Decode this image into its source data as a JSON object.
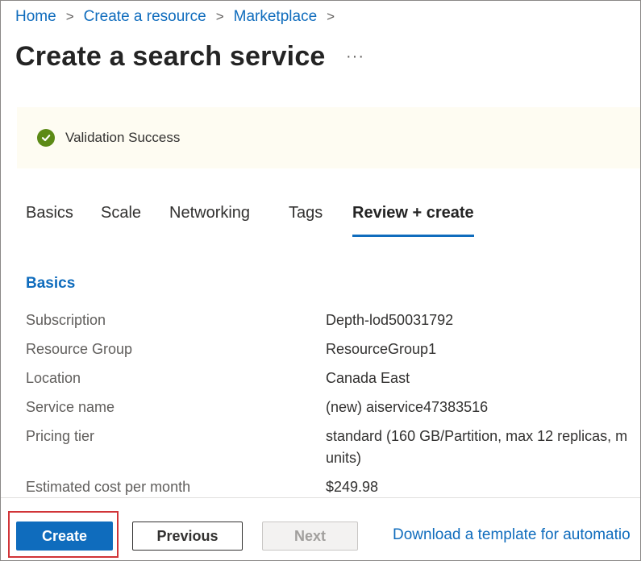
{
  "breadcrumb": {
    "items": [
      "Home",
      "Create a resource",
      "Marketplace"
    ],
    "separator": ">"
  },
  "page": {
    "title": "Create a search service",
    "more_label": "···"
  },
  "banner": {
    "icon": "check-circle-icon",
    "text": "Validation Success",
    "color_success": "#5c8a16"
  },
  "tabs": [
    {
      "label": "Basics"
    },
    {
      "label": "Scale"
    },
    {
      "label": "Networking"
    },
    {
      "label": "Tags"
    },
    {
      "label": "Review + create",
      "active": true
    }
  ],
  "section": {
    "title": "Basics",
    "rows": [
      {
        "label": "Subscription",
        "value": "Depth-lod50031792"
      },
      {
        "label": "Resource Group",
        "value": "ResourceGroup1"
      },
      {
        "label": "Location",
        "value": "Canada East"
      },
      {
        "label": "Service name",
        "value": "(new) aiservice47383516"
      },
      {
        "label": "Pricing tier",
        "value": "standard (160 GB/Partition, max 12 replicas, m",
        "value_line2": "units)"
      },
      {
        "label": "Estimated cost per month",
        "value": "$249.98"
      }
    ]
  },
  "footer": {
    "create_label": "Create",
    "previous_label": "Previous",
    "next_label": "Next",
    "download_label": "Download a template for automatio"
  },
  "colors": {
    "accent": "#0f6cbd",
    "highlight": "#d13438"
  }
}
